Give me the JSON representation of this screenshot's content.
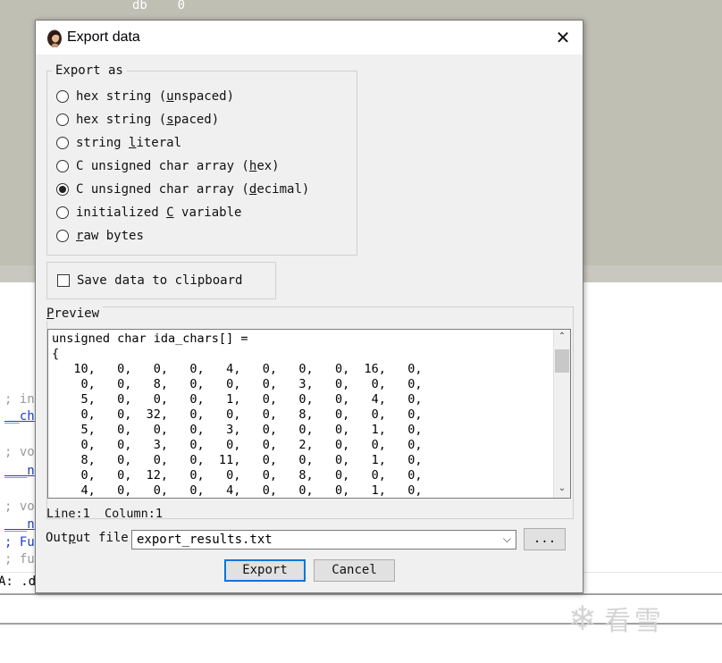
{
  "background": {
    "top_snippet": "db    0",
    "left_fragments": [
      "; in",
      "__ch",
      "; vo",
      "___n",
      "; vo",
      "___n",
      "; Fu",
      "; fu",
      "A: .d"
    ],
    "watermark_text": "看雪"
  },
  "dialog": {
    "title": "Export data",
    "close_icon": "close-icon",
    "export_as": {
      "title": "Export as",
      "options": [
        {
          "pre": "hex string (",
          "key": "u",
          "post": "nspaced)",
          "checked": false
        },
        {
          "pre": "hex string (",
          "key": "s",
          "post": "paced)",
          "checked": false
        },
        {
          "pre": "string ",
          "key": "l",
          "post": "iteral",
          "checked": false
        },
        {
          "pre": "C unsigned char array (",
          "key": "h",
          "post": "ex)",
          "checked": false
        },
        {
          "pre": "C unsigned char array (",
          "key": "d",
          "post": "ecimal)",
          "checked": true
        },
        {
          "pre": "initialized ",
          "key": "C",
          "post": " variable",
          "checked": false
        },
        {
          "pre": "",
          "key": "r",
          "post": "aw bytes",
          "checked": false
        }
      ]
    },
    "save_to_clipboard": {
      "label": "Save data to clipboard",
      "checked": false
    },
    "preview": {
      "title_key": "P",
      "title_rest": "review",
      "lines": [
        "unsigned char ida_chars[] =",
        "{",
        "   10,   0,   0,   0,   4,   0,   0,   0,  16,   0,",
        "    0,   0,   8,   0,   0,   0,   3,   0,   0,   0,",
        "    5,   0,   0,   0,   1,   0,   0,   0,   4,   0,",
        "    0,   0,  32,   0,   0,   0,   8,   0,   0,   0,",
        "    5,   0,   0,   0,   3,   0,   0,   0,   1,   0,",
        "    0,   0,   3,   0,   0,   0,   2,   0,   0,   0,",
        "    8,   0,   0,   0,  11,   0,   0,   0,   1,   0,",
        "    0,   0,  12,   0,   0,   0,   8,   0,   0,   0,",
        "    4,   0,   0,   0,   4,   0,   0,   0,   1,   0,"
      ]
    },
    "status": "Line:1  Column:1",
    "output_file": {
      "label_key": "p",
      "label_pre": "Out",
      "label_post": "ut file",
      "value": "export_results.txt",
      "browse_label": "..."
    },
    "buttons": {
      "export": "Export",
      "cancel": "Cancel"
    }
  }
}
